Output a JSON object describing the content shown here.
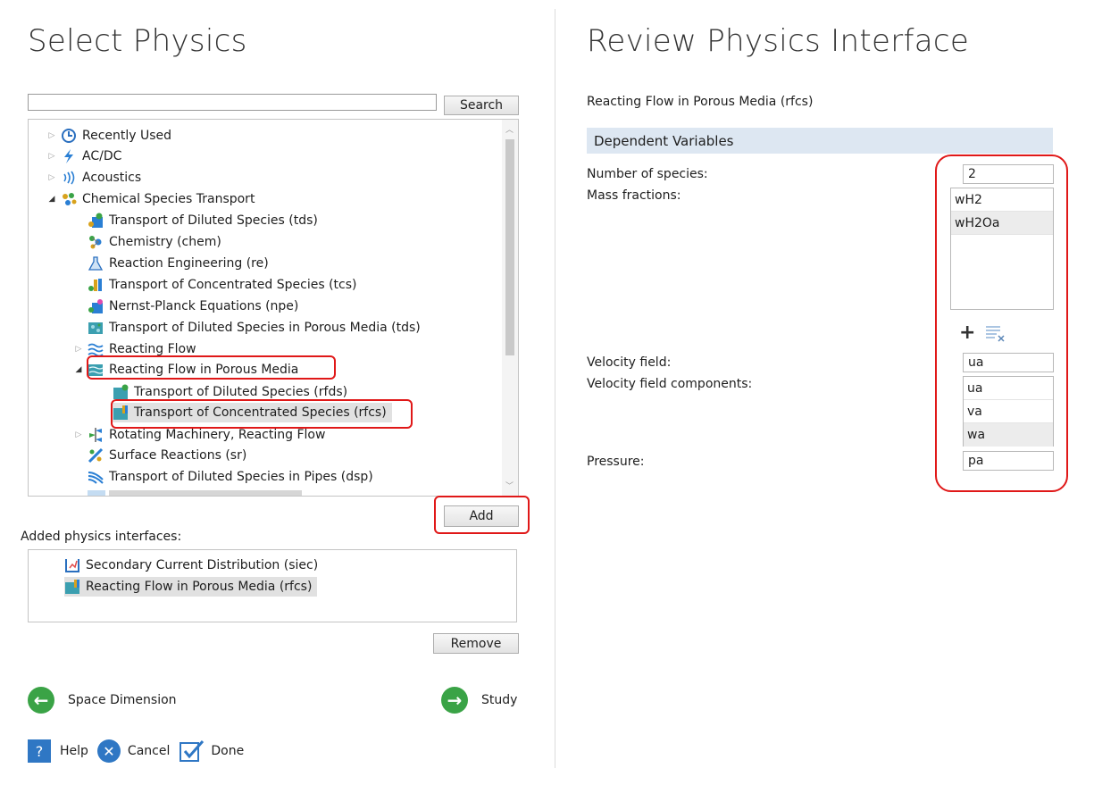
{
  "left": {
    "title": "Select Physics",
    "search": {
      "value": "",
      "button": "Search"
    },
    "tree": [
      {
        "label": "Recently Used",
        "icon": "clock-icon",
        "toggle": "collapsed"
      },
      {
        "label": "AC/DC",
        "icon": "acdc-icon",
        "toggle": "collapsed"
      },
      {
        "label": "Acoustics",
        "icon": "acoustics-icon",
        "toggle": "collapsed"
      },
      {
        "label": "Chemical Species Transport",
        "icon": "chemical-species-icon",
        "toggle": "expanded"
      },
      {
        "label": "Transport of Diluted Species (tds)",
        "icon": "diluted-species-icon"
      },
      {
        "label": "Chemistry (chem)",
        "icon": "chemistry-icon"
      },
      {
        "label": "Reaction Engineering (re)",
        "icon": "flask-icon"
      },
      {
        "label": "Transport of Concentrated Species (tcs)",
        "icon": "concentrated-species-icon"
      },
      {
        "label": "Nernst-Planck Equations (npe)",
        "icon": "nernst-planck-icon"
      },
      {
        "label": "Transport of Diluted Species in Porous Media (tds)",
        "icon": "porous-media-icon"
      },
      {
        "label": "Reacting Flow",
        "icon": "reacting-flow-icon",
        "toggle": "collapsed"
      },
      {
        "label": "Reacting Flow in Porous Media",
        "icon": "porous-reacting-flow-icon",
        "toggle": "expanded"
      },
      {
        "label": "Transport of Diluted Species (rfds)",
        "icon": "diluted-species-icon"
      },
      {
        "label": "Transport of Concentrated Species (rfcs)",
        "icon": "concentrated-species-icon",
        "selected": true
      },
      {
        "label": "Rotating Machinery, Reacting Flow",
        "icon": "rotating-machinery-icon",
        "toggle": "collapsed"
      },
      {
        "label": "Surface Reactions (sr)",
        "icon": "surface-reactions-icon"
      },
      {
        "label": "Transport of Diluted Species in Pipes (dsp)",
        "icon": "pipes-icon"
      }
    ],
    "add_button": "Add",
    "added_label": "Added physics interfaces:",
    "added": [
      {
        "label": "Secondary Current Distribution (siec)",
        "icon": "current-distribution-icon"
      },
      {
        "label": "Reacting Flow in Porous Media (rfcs)",
        "icon": "porous-reacting-flow-icon",
        "selected": true
      }
    ],
    "remove_button": "Remove",
    "nav_back": "Space Dimension",
    "nav_next": "Study",
    "help": "Help",
    "cancel": "Cancel",
    "done": "Done"
  },
  "right": {
    "title": "Review Physics Interface",
    "interface_name": "Reacting Flow in Porous Media (rfcs)",
    "section": "Dependent Variables",
    "species_label": "Number of species:",
    "species_value": "2",
    "mass_label": "Mass fractions:",
    "mass_fractions": [
      "wH2",
      "wH2Oa"
    ],
    "velocity_label": "Velocity field:",
    "velocity_value": "ua",
    "components_label": "Velocity field components:",
    "components": [
      "ua",
      "va",
      "wa"
    ],
    "pressure_label": "Pressure:",
    "pressure_value": "pa"
  },
  "colors": {
    "highlight_red": "#e01818",
    "nav_green": "#3aa346",
    "section_bg": "#dde7f2"
  }
}
